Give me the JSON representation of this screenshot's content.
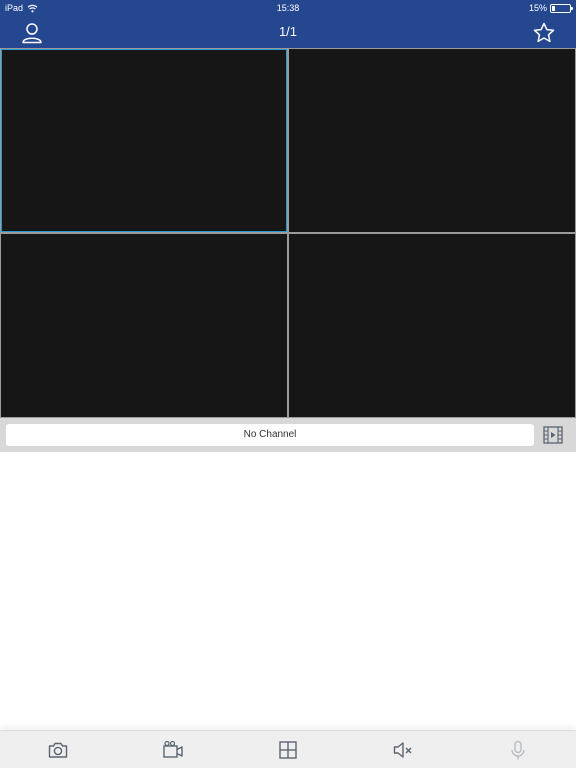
{
  "status_bar": {
    "device": "iPad",
    "time": "15:38",
    "battery": "15%",
    "battery_level": 0.15,
    "wifi_icon": "wifi-icon"
  },
  "nav": {
    "title": "1/1",
    "left_icon": "user-icon",
    "right_icon": "star-icon"
  },
  "video_grid": {
    "layout": "2x2",
    "selected_pane": 1,
    "colors": {
      "pane_bg": "#161616",
      "selected_border": "#2a9bd0",
      "divider": "#9a9a9a"
    }
  },
  "channel_bar": {
    "channel_text": "No Channel",
    "playback_icon": "playback-film-icon"
  },
  "toolbar": {
    "items": [
      {
        "icon": "camera-icon",
        "action": "snapshot"
      },
      {
        "icon": "video-record-icon",
        "action": "record"
      },
      {
        "icon": "grid-layout-icon",
        "action": "layout"
      },
      {
        "icon": "speaker-mute-icon",
        "action": "audio"
      },
      {
        "icon": "microphone-icon",
        "action": "talk",
        "disabled": true
      }
    ]
  },
  "colors": {
    "header_bg": "#24478f",
    "toolbar_bg": "#efefef",
    "channel_bar_bg": "#d8d8d8",
    "icon_color": "#5a6470",
    "icon_disabled": "#b8bcc2"
  }
}
